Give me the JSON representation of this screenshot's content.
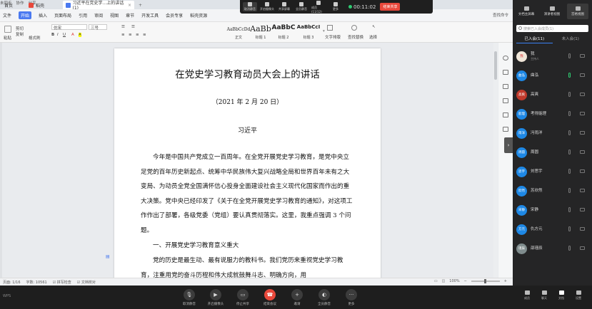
{
  "tabs": [
    {
      "label": "首页"
    },
    {
      "label": "稻壳"
    },
    {
      "label": "习近平在党史学...上的讲话(1)"
    }
  ],
  "tabbar_right": [
    "未同步",
    "协作",
    "分享"
  ],
  "meeting_toolbar": {
    "items": [
      "取消静音",
      "开启摄像头",
      "共享屏幕",
      "全员静音",
      "成员(11/12)",
      "更多"
    ],
    "timer": "00:11:02",
    "end_share": "结束共享"
  },
  "menus": [
    "文件",
    "开始",
    "插入",
    "页面布局",
    "引用",
    "审阅",
    "视图",
    "章节",
    "开发工具",
    "会员专享",
    "稻壳资源"
  ],
  "menu_right": [
    "查找命令",
    "分享",
    "协作"
  ],
  "ribbon": {
    "clipboard": [
      "剪切",
      "复制",
      "粘贴",
      "格式刷"
    ],
    "font_name": "仿宋",
    "font_size": "三号",
    "styles": [
      {
        "preview": "AaBbCcDd",
        "label": "正文"
      },
      {
        "preview": "AaBb",
        "label": "标题 1"
      },
      {
        "preview": "AaBbC",
        "label": "标题 2"
      },
      {
        "preview": "AaBbCcI",
        "label": "标题 3"
      }
    ],
    "tools": [
      "文字排版",
      "查找替换",
      "选择"
    ]
  },
  "document": {
    "title": "在党史学习教育动员大会上的讲话",
    "date": "（2021 年 2 月 20 日）",
    "author": "习近平",
    "paragraphs": [
      "今年是中国共产党成立一百周年。在全党开展党史学习教育，是党中央立足党的百年历史新起点、统筹中华民族伟大复兴战略全局和世界百年未有之大变局、为动员全党全国满怀信心投身全面建设社会主义现代化国家而作出的重大决策。党中央已经印发了《关于在全党开展党史学习教育的通知》，对这项工作作出了部署，各级党委（党组）要认真贯彻落实。这里，我重点强调 3 个问题。",
      "一、开展党史学习教育意义重大",
      "党的历史是最生动、最有说服力的教科书。我们党历来重视党史学习教育，注重用党的奋斗历程和伟大成就鼓舞斗志、明确方向，用"
    ]
  },
  "statusbar": {
    "page": "页面: 1/16",
    "words": "字数: 10561",
    "spell": "拼写检查",
    "compare": "文档校对",
    "zoom": "100%"
  },
  "bottom_bar": {
    "brand": "WPS",
    "buttons": [
      "取消静音",
      "开启摄像头",
      "停止共享",
      "结束会议",
      "邀请",
      "全员静音",
      "更多"
    ]
  },
  "right_panel": {
    "top_buttons": [
      "文档主屏幕",
      "演讲者视图",
      "宫格视图"
    ],
    "search_placeholder": "搜索已入会成员(1)",
    "tabs": [
      "已入会(11)",
      "未入会(1)"
    ],
    "members": [
      {
        "name": "我",
        "sub": "主持人",
        "avatar_text": "我"
      },
      {
        "name": "曲泓",
        "avatar_text": "曲泓"
      },
      {
        "name": "高爽",
        "avatar_text": "高爽"
      },
      {
        "name": "考得能理",
        "avatar_text": "能理"
      },
      {
        "name": "冯雨洋",
        "avatar_text": "雨洋"
      },
      {
        "name": "周圆",
        "avatar_text": "周圆"
      },
      {
        "name": "刘思宇",
        "avatar_text": "思宇"
      },
      {
        "name": "苏欣然",
        "avatar_text": "欣然"
      },
      {
        "name": "宋静",
        "avatar_text": "宋静"
      },
      {
        "name": "仇方元",
        "avatar_text": "方元"
      },
      {
        "name": "邵瑾辰",
        "avatar_text": "瑾辰"
      }
    ],
    "bottom_buttons": [
      "成员",
      "聊天",
      "文档",
      "设置"
    ]
  },
  "colors": {
    "accent": "#4a79f0",
    "end_red": "#e8483b",
    "member_blue": "#1e88e5"
  }
}
